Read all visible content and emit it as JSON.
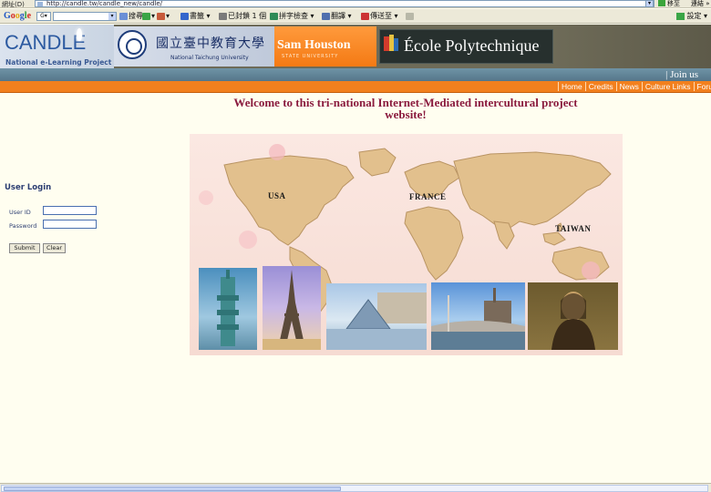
{
  "browser": {
    "address_label": "網址(D)",
    "url": "http://candle.tw/candle_new/candle/",
    "go_label": "移至",
    "links_label": "連結 »",
    "google": {
      "logo": [
        "G",
        "o",
        "o",
        "g",
        "l",
        "e"
      ],
      "select_label": "G▾",
      "toolbar": [
        {
          "label": "搜尋 ▾",
          "icon": "search-icon"
        },
        {
          "label": "▾",
          "icon": "pagerank-icon"
        },
        {
          "label": "▾",
          "icon": "popup-blocker-icon"
        },
        {
          "label": "書籤 ▾",
          "icon": "bookmark-star-icon"
        },
        {
          "label": "已封鎖 1 個",
          "icon": "blocked-icon"
        },
        {
          "label": "拼字檢查 ▾",
          "icon": "spellcheck-icon"
        },
        {
          "label": "翻譯 ▾",
          "icon": "translate-icon"
        },
        {
          "label": "傳送至 ▾",
          "icon": "send-to-icon"
        },
        {
          "label": "",
          "icon": "highlight-icon"
        }
      ],
      "settings_label": "設定 ▾"
    }
  },
  "banner": {
    "candle_title": "CANDLE",
    "candle_subtitle": "National e-Learning Project",
    "ntcu_chinese": "國立臺中教育大學",
    "ntcu_english": "National Taichung University",
    "shsu_name": "Sam Houston",
    "shsu_sub": "STATE UNIVERSITY",
    "polytechnique_name": "École Polytechnique",
    "join_us": "| Join us"
  },
  "nav": {
    "items": [
      "Home",
      "Credits",
      "News",
      "Culture Links",
      "Forum"
    ]
  },
  "main": {
    "welcome_line1": "Welcome to this tri-national Internet-Mediated intercultural project",
    "welcome_line2": "website!",
    "map_labels": {
      "usa": "USA",
      "france": "FRANCE",
      "taiwan": "TAIWAN"
    }
  },
  "login": {
    "title": "User Login",
    "user_id_label": "User ID",
    "password_label": "Password",
    "submit_label": "Submit",
    "clear_label": "Clear"
  },
  "colors": {
    "orange_nav": "#f2801e",
    "title_crimson": "#8a1a3e",
    "login_blue": "#2c3e72",
    "page_background": "#fffef0"
  }
}
